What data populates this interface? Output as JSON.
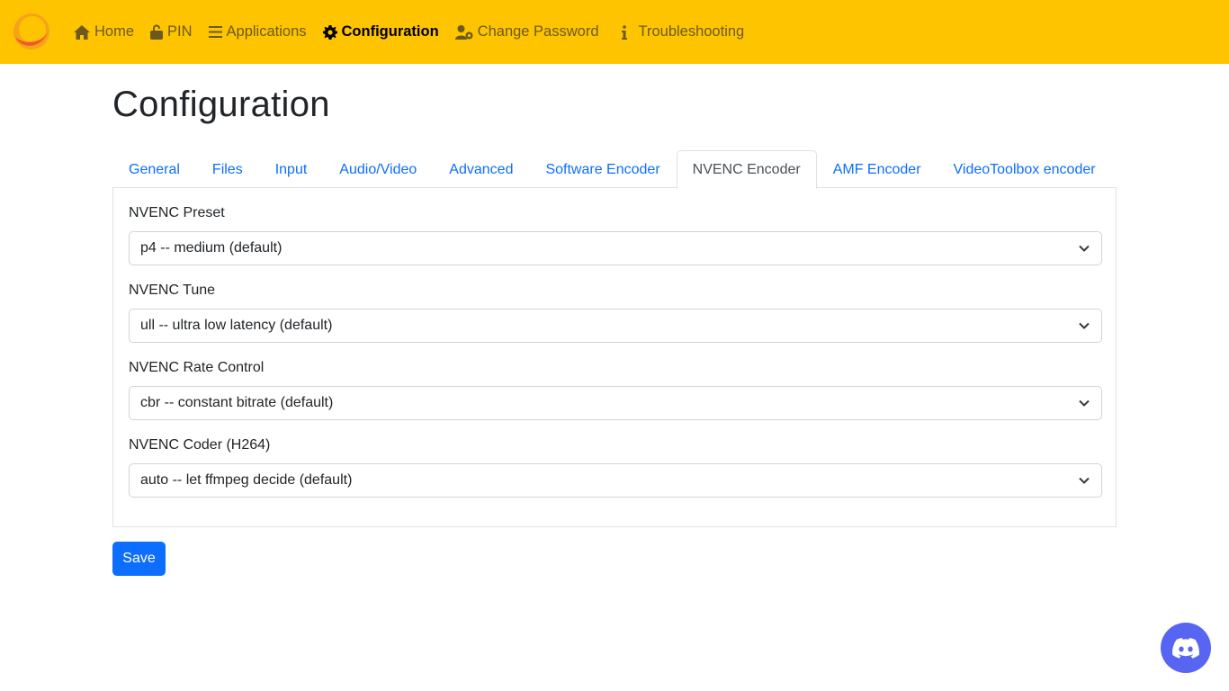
{
  "nav": {
    "items": [
      {
        "label": "Home",
        "icon": "home-icon"
      },
      {
        "label": "PIN",
        "icon": "unlock-icon"
      },
      {
        "label": "Applications",
        "icon": "bars-icon"
      },
      {
        "label": "Configuration",
        "icon": "gear-icon",
        "active": true
      },
      {
        "label": "Change Password",
        "icon": "user-gear-icon"
      },
      {
        "label": "Troubleshooting",
        "icon": "info-icon"
      }
    ]
  },
  "page": {
    "title": "Configuration"
  },
  "tabs": [
    {
      "label": "General"
    },
    {
      "label": "Files"
    },
    {
      "label": "Input"
    },
    {
      "label": "Audio/Video"
    },
    {
      "label": "Advanced"
    },
    {
      "label": "Software Encoder"
    },
    {
      "label": "NVENC Encoder",
      "active": true
    },
    {
      "label": "AMF Encoder"
    },
    {
      "label": "VideoToolbox encoder"
    }
  ],
  "fields": [
    {
      "label": "NVENC Preset",
      "value": "p4 -- medium (default)"
    },
    {
      "label": "NVENC Tune",
      "value": "ull -- ultra low latency (default)"
    },
    {
      "label": "NVENC Rate Control",
      "value": "cbr -- constant bitrate (default)"
    },
    {
      "label": "NVENC Coder (H264)",
      "value": "auto -- let ffmpeg decide (default)"
    }
  ],
  "actions": {
    "save_label": "Save"
  },
  "colors": {
    "navbar": "#ffc400",
    "link": "#0d6efd",
    "primary_button": "#0d6efd",
    "discord": "#5865f2"
  }
}
